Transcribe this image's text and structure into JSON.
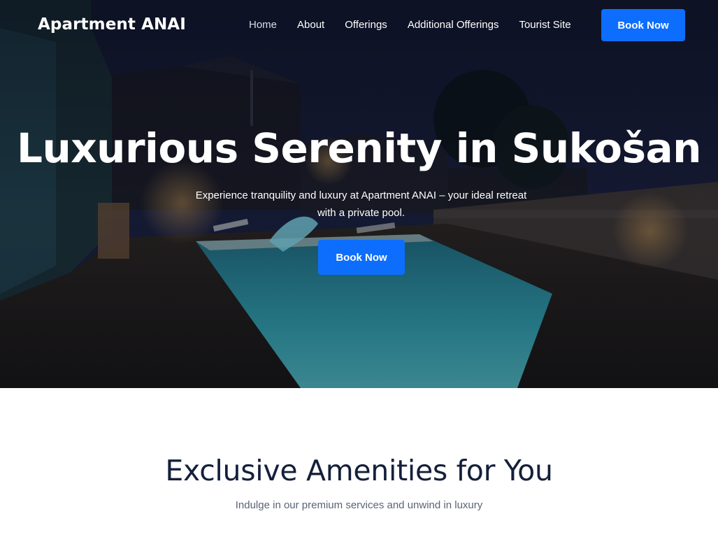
{
  "nav": {
    "brand": "Apartment ANAI",
    "links": [
      {
        "label": "Home",
        "active": true
      },
      {
        "label": "About"
      },
      {
        "label": "Offerings"
      },
      {
        "label": "Additional Offerings"
      },
      {
        "label": "Tourist Site"
      }
    ],
    "cta_label": "Book Now"
  },
  "hero": {
    "title": "Luxurious Serenity in Sukošan",
    "subtitle_line1": "Experience tranquility and luxury at Apartment ANAI – your ideal retreat",
    "subtitle_line2": "with a private pool.",
    "cta_label": "Book Now",
    "image_description": "night-pool-courtyard"
  },
  "amenities": {
    "title": "Exclusive Amenities for You",
    "subtitle": "Indulge in our premium services and unwind in luxury"
  },
  "colors": {
    "accent": "#0d6efd",
    "heading_dark": "#14203a",
    "muted_text": "#5a6476",
    "hero_overlay": "#060a16"
  }
}
